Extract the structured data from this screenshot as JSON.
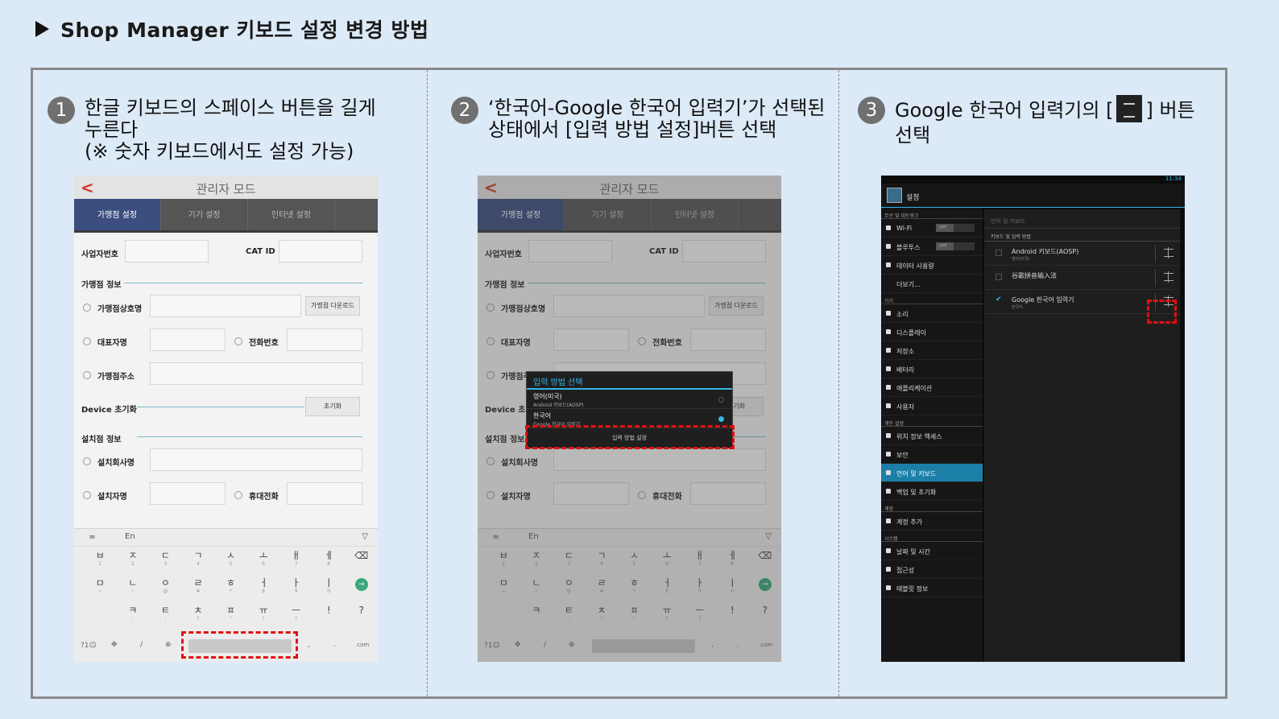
{
  "title": "Shop Manager 키보드 설정 변경 방법",
  "steps": [
    {
      "num": "1",
      "line1": "한글 키보드의 스페이스 버튼을 길게",
      "line2": "누른다",
      "line3": "(※ 숫자 키보드에서도 설정 가능)"
    },
    {
      "num": "2",
      "line1": "‘한국어-Google 한국어 입력기’가 선택된",
      "line2": "상태에서 [입력 방법 설정]버튼 선택"
    },
    {
      "num": "3",
      "line1a": "Google 한국어 입력기의 [",
      "line1b": "] 버튼",
      "line2": "선택"
    }
  ],
  "admin": {
    "back": "<",
    "title": "관리자 모드",
    "tabs": [
      "가맹점 설정",
      "기기 설정",
      "인터넷 설정"
    ],
    "business_no": "사업자번호",
    "cat_id": "CAT ID",
    "store_info": "가맹점 정보",
    "store_name": "가맹점상호명",
    "store_download": "가맹점 다운로드",
    "owner": "대표자명",
    "phone": "전화번호",
    "address": "가맹점주소",
    "device_reset": "Device 초기화",
    "reset_btn": "초기화",
    "install_info": "설치점 정보",
    "installer_company": "설치회사명",
    "installer": "설치자명",
    "mobile": "휴대전화"
  },
  "keyboard": {
    "hangul": "ᄒ",
    "en": "En",
    "row1": [
      [
        "ㅂ",
        "1"
      ],
      [
        "ㅈ",
        "2"
      ],
      [
        "ㄷ",
        "3"
      ],
      [
        "ㄱ",
        "4"
      ],
      [
        "ㅅ",
        "5"
      ],
      [
        "ㅗ",
        "6"
      ],
      [
        "ㅐ",
        "7"
      ],
      [
        "ㅔ",
        "8"
      ]
    ],
    "row2": [
      [
        "ㅁ",
        "~"
      ],
      [
        "ㄴ",
        "!"
      ],
      [
        "ㅇ",
        "@"
      ],
      [
        "ㄹ",
        "#"
      ],
      [
        "ㅎ",
        "*"
      ],
      [
        "ㅓ",
        "8"
      ],
      [
        "ㅏ",
        "9"
      ],
      [
        "ㅣ",
        "0"
      ]
    ],
    "row3": [
      [
        "ㅋ",
        ";"
      ],
      [
        "ㅌ",
        ":"
      ],
      [
        "ㅊ",
        "?"
      ],
      [
        "ㅍ",
        "\""
      ],
      [
        "ㅠ",
        "("
      ],
      [
        "ㅡ",
        ")"
      ],
      [
        "!",
        ""
      ],
      [
        "?",
        ""
      ]
    ],
    "sym": "?1☺",
    "slash": "/",
    "comma": ",",
    "dot": ".",
    "com": ".com"
  },
  "dialog": {
    "title": "입력 방법 선택",
    "opt1": "영어(미국)",
    "opt1_sub": "Android 키보드(AOSP)",
    "opt2": "한국어",
    "opt2_sub": "Google 한국어 입력기",
    "button": "입력 방법 설정"
  },
  "android": {
    "time": "11:34",
    "header": "설정",
    "cat_wireless": "무선 및 네트워크",
    "wifi": "Wi-Fi",
    "bluetooth": "블루투스",
    "off": "OFF",
    "data_usage": "데이터 사용량",
    "more": "더보기...",
    "cat_device": "기기",
    "sound": "소리",
    "display": "디스플레이",
    "storage": "저장소",
    "battery": "배터리",
    "apps": "애플리케이션",
    "users": "사용자",
    "cat_personal": "개인 설정",
    "location": "위치 정보 액세스",
    "security": "보안",
    "language": "언어 및 키보드",
    "backup": "백업 및 초기화",
    "cat_account": "계정",
    "add_account": "계정 추가",
    "cat_system": "시스템",
    "datetime": "날짜 및 시간",
    "accessibility": "접근성",
    "tablet_info": "태블릿 정보",
    "r_header": "언어 및 키보드",
    "r_sub": "키보드 및 입력 방법",
    "ime1": "Android 키보드(AOSP)",
    "ime1_sub": "영어(미국)",
    "ime2": "谷歌拼音输入法",
    "ime3": "Google 한국어 입력기",
    "ime3_sub": "한국어"
  }
}
